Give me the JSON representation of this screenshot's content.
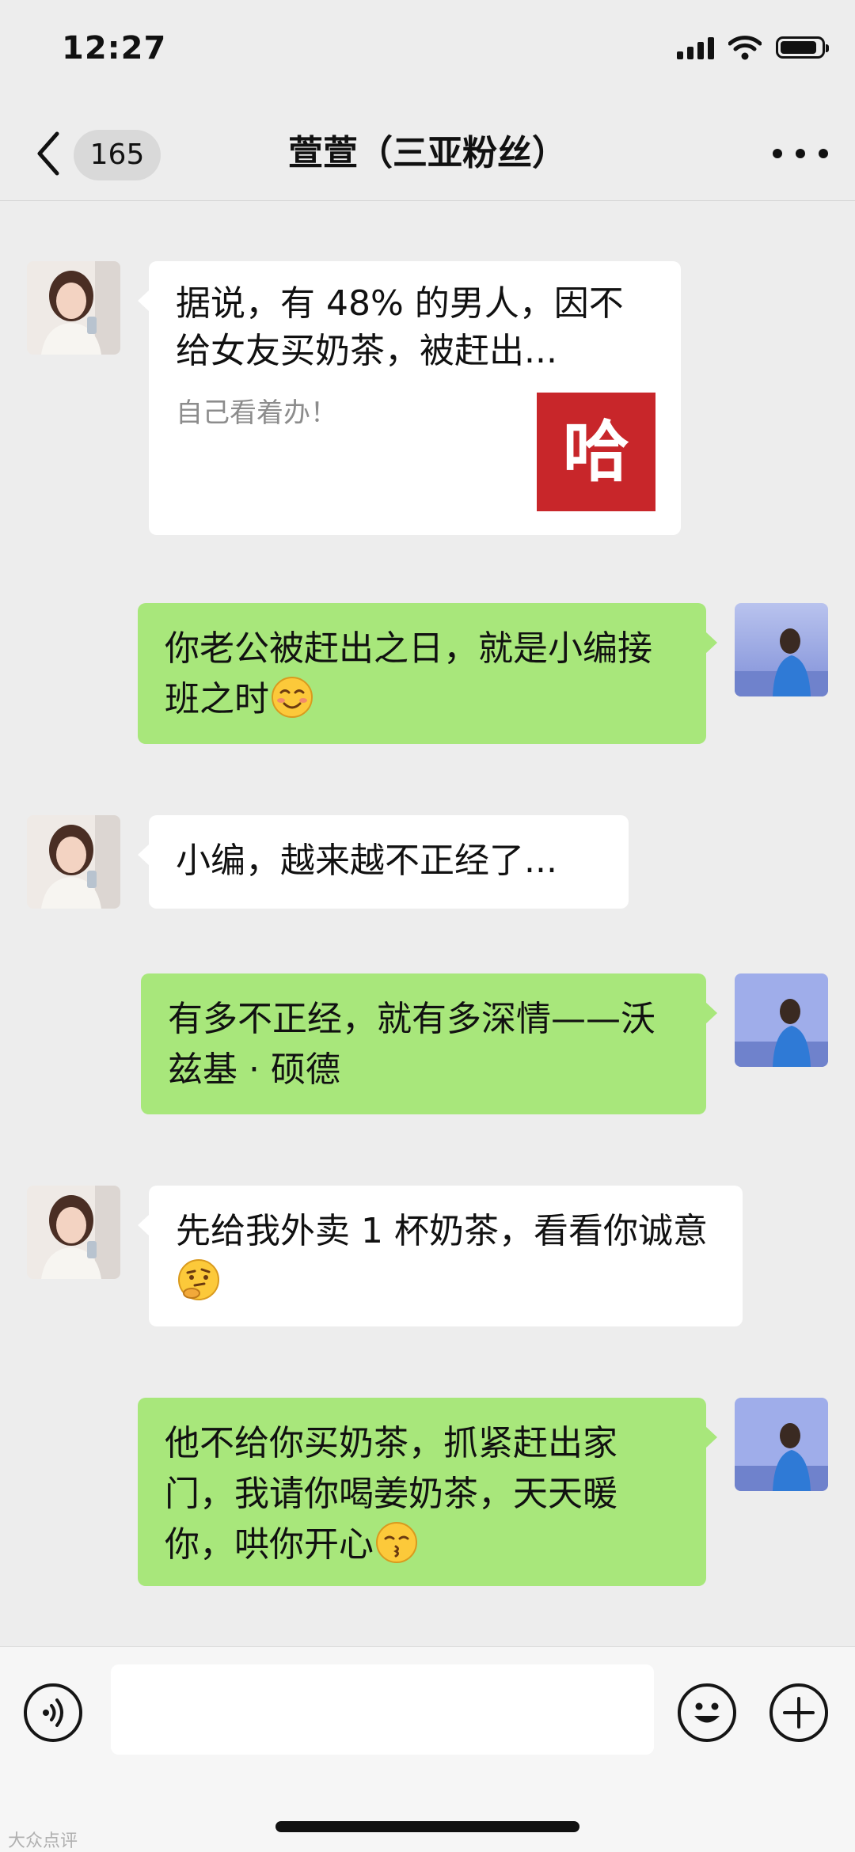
{
  "status_bar": {
    "time": "12:27",
    "battery_level": 0.9,
    "icons": [
      "signal-icon",
      "wifi-icon",
      "battery-icon"
    ]
  },
  "nav": {
    "back_icon": "chevron-left-icon",
    "unread_count": "165",
    "title": "萱萱（三亚粉丝）",
    "more_icon": "more-dots-icon"
  },
  "messages": [
    {
      "side": "left",
      "type": "link-card",
      "title": "据说，有 48% 的男人，因不给女友买奶茶，被赶出...",
      "description": "自己看着办！",
      "thumb_text": "哈"
    },
    {
      "side": "right",
      "type": "text",
      "text": "你老公被赶出之日，就是小编接班之时",
      "emoji": "smiling-blush"
    },
    {
      "side": "left",
      "type": "text",
      "text": "小编，越来越不正经了..."
    },
    {
      "side": "right",
      "type": "text",
      "text": "有多不正经，就有多深情——沃兹基 · 硕德"
    },
    {
      "side": "left",
      "type": "text",
      "text": "先给我外卖 1 杯奶茶，看看你诚意",
      "emoji": "thinking-face"
    },
    {
      "side": "right",
      "type": "text",
      "text": "他不给你买奶茶，抓紧赶出家门，我请你喝姜奶茶，天天暖你，哄你开心",
      "emoji": "kissing-face"
    }
  ],
  "input_bar": {
    "voice_icon": "voice-icon",
    "input_value": "",
    "emoji_icon": "emoji-icon",
    "plus_icon": "plus-icon"
  },
  "watermark": "大众点评",
  "colors": {
    "background": "#ededed",
    "bubble_sent": "#a8e77b",
    "bubble_received": "#ffffff",
    "thumb": "#c8262a"
  }
}
